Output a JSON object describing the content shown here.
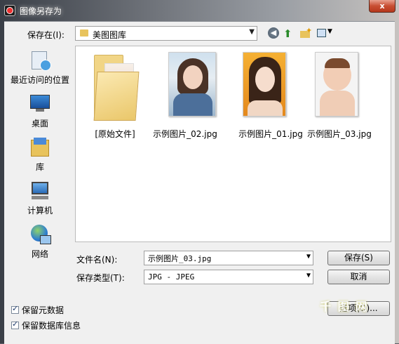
{
  "window": {
    "title": "图像另存为",
    "close_label": "x"
  },
  "toolbar": {
    "save_in_label": "保存在(I):",
    "location": "美图图库",
    "icons": [
      "back-icon",
      "up-folder-icon",
      "new-folder-icon",
      "view-menu-icon"
    ]
  },
  "places": [
    {
      "label": "最近访问的位置",
      "icon": "recent-places-icon"
    },
    {
      "label": "桌面",
      "icon": "desktop-icon"
    },
    {
      "label": "库",
      "icon": "libraries-icon"
    },
    {
      "label": "计算机",
      "icon": "computer-icon"
    },
    {
      "label": "网络",
      "icon": "network-icon"
    }
  ],
  "files": [
    {
      "name": "[原始文件]",
      "type": "folder"
    },
    {
      "name": "示例图片_02.jpg",
      "type": "image"
    },
    {
      "name": "示例图片_01.jpg",
      "type": "image"
    },
    {
      "name": "示例图片_03.jpg",
      "type": "image"
    }
  ],
  "form": {
    "filename_label": "文件名(N):",
    "filename_value": "示例图片_03.jpg",
    "filetype_label": "保存类型(T):",
    "filetype_value": "JPG - JPEG",
    "save_button": "保存(S)",
    "cancel_button": "取消",
    "options_button": "选项(O)..."
  },
  "checkboxes": [
    {
      "label": "保留元数据",
      "checked": true
    },
    {
      "label": "保留数据库信息",
      "checked": true
    }
  ],
  "watermark": "千 图 网"
}
